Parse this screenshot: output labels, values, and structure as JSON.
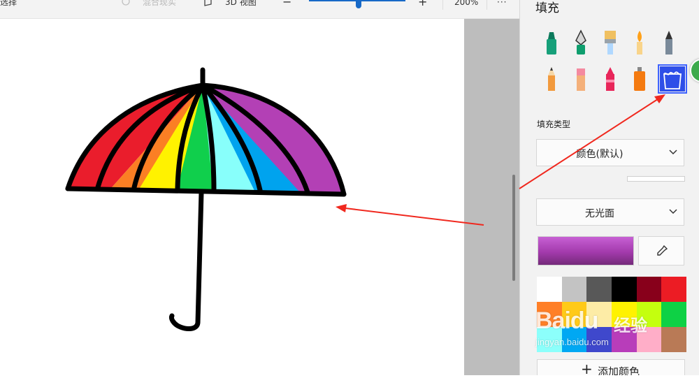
{
  "toolbar": {
    "select_label": "选择",
    "mixed_reality_label": "混合现实",
    "view3d_label": "3D 视图",
    "zoom_value": "200%",
    "zoom_level_fraction": 0.51,
    "more_label": "···"
  },
  "canvas": {
    "umbrella_colors": [
      "#ea1d2c",
      "#fb7f24",
      "#fff200",
      "#10cf4c",
      "#88fffb",
      "#00a3ee",
      "#b340b5"
    ]
  },
  "panel": {
    "title": "填充",
    "brushes": [
      {
        "name": "marker",
        "icon": "marker-icon",
        "color": "#17a07a"
      },
      {
        "name": "calligraphy-pen",
        "icon": "calligraphy-pen-icon",
        "color": "#0f9e6e"
      },
      {
        "name": "oil-brush",
        "icon": "oil-brush-icon",
        "color": "#f0c060"
      },
      {
        "name": "watercolor",
        "icon": "watercolor-brush-icon",
        "color": "#ffa11a"
      },
      {
        "name": "pixel-pen",
        "icon": "pixel-pen-icon",
        "color": "#7a8a9a"
      },
      {
        "name": "pencil",
        "icon": "pencil-icon",
        "color": "#f29a3d"
      },
      {
        "name": "eraser",
        "icon": "eraser-icon",
        "color": "#f48aa0"
      },
      {
        "name": "crayon",
        "icon": "crayon-icon",
        "color": "#e8265a"
      },
      {
        "name": "spray-can",
        "icon": "spray-can-icon",
        "color": "#f47a10"
      },
      {
        "name": "fill",
        "icon": "fill-bucket-icon",
        "color": "#2e4fe8",
        "selected": true
      }
    ],
    "fill_type_label": "填充类型",
    "fill_type_value": "颜色(默认)",
    "finish_value": "无光面",
    "current_color": "#a33aac",
    "swatches": [
      "#ffffff",
      "#c3c3c3",
      "#585858",
      "#000000",
      "#88001b",
      "#ec1c24",
      "#ff7f27",
      "#ffca18",
      "#fdeca6",
      "#fff200",
      "#c4ff0e",
      "#0ed145",
      "#8cfffb",
      "#00a8f3",
      "#3f48cc",
      "#b83dba",
      "#ffaec8",
      "#b97a56"
    ],
    "add_color_label": "添加颜色"
  },
  "watermark": {
    "logo": "Baidu",
    "cn": "经验",
    "sub": "jingyan.baidu.com"
  }
}
